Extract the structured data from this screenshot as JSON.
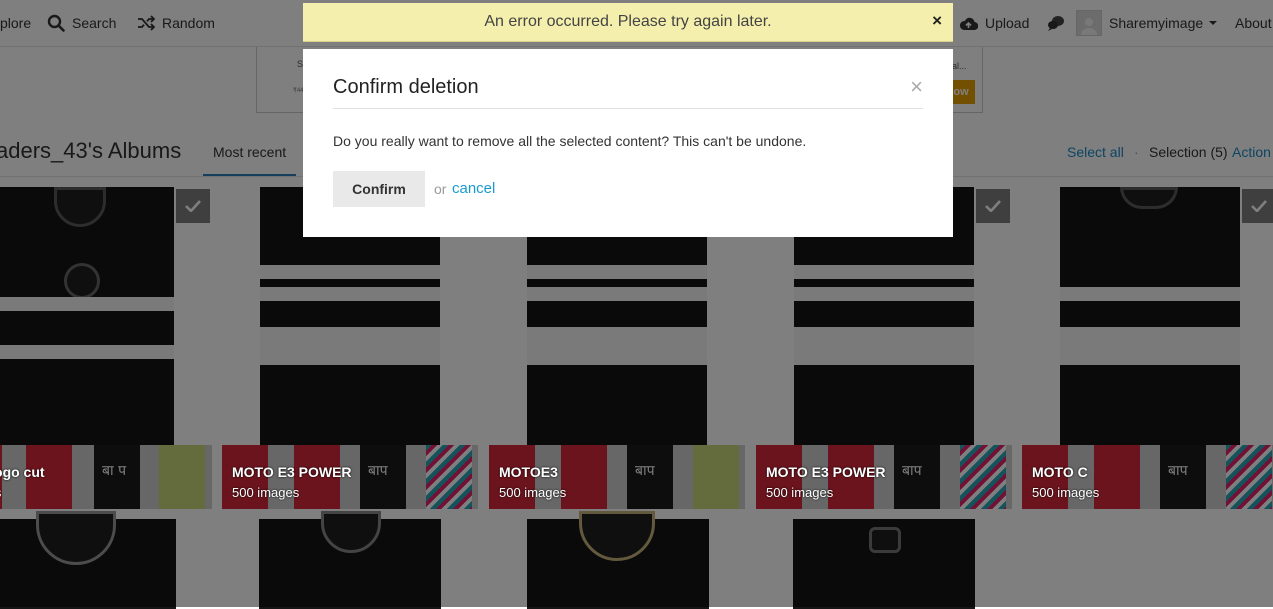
{
  "nav": {
    "explore": "plore",
    "search": "Search",
    "random": "Random",
    "upload": "Upload",
    "user": "Sharemyimage",
    "about": "About"
  },
  "ad": {
    "line1": "S",
    "line2": "₹44",
    "line3": "al...",
    "button": "ow"
  },
  "page": {
    "title": "aders_43's Albums",
    "tab_recent": "Most recent",
    "select_all": "Select all",
    "separator": "·",
    "selection": "Selection (5)",
    "actions": "Action"
  },
  "albums": [
    {
      "name": "x4 Logo cut",
      "count": "nages",
      "checked": true
    },
    {
      "name": "MOTO E3 POWER",
      "count": "500 images",
      "checked": false
    },
    {
      "name": "MOTOE3",
      "count": "500 images",
      "checked": false
    },
    {
      "name": "MOTO E3 POWER",
      "count": "500 images",
      "checked": true
    },
    {
      "name": "MOTO C",
      "count": "500 images",
      "checked": true
    }
  ],
  "alert": {
    "message": "An error occurred. Please try again later.",
    "close": "×"
  },
  "modal": {
    "title": "Confirm deletion",
    "close": "×",
    "body": "Do you really want to remove all the selected content? This can't be undone.",
    "confirm": "Confirm",
    "or": "or",
    "cancel": "cancel"
  },
  "colors": {
    "link": "#1a8bc4",
    "alert_bg": "#f5efad",
    "tab_underline": "#2b7fb8"
  },
  "icons": [
    "search-icon",
    "random-icon",
    "upload-icon",
    "notifications-icon",
    "caret-down-icon",
    "check-icon",
    "close-icon"
  ]
}
